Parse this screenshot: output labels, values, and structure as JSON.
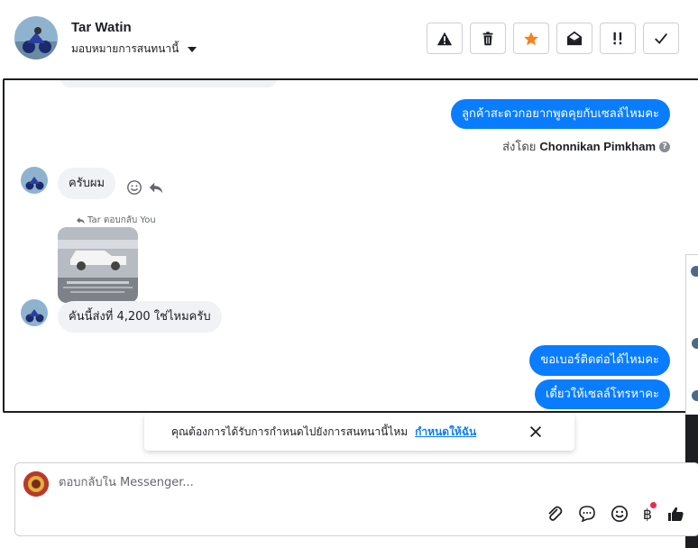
{
  "header": {
    "contact_name": "Tar Watin",
    "assign_label": "มอบหมายการสนทนานี้",
    "toolbar": [
      {
        "icon": "warning-icon",
        "name": "mark-spam-button"
      },
      {
        "icon": "trash-icon",
        "name": "delete-button"
      },
      {
        "icon": "star-icon",
        "name": "star-button"
      },
      {
        "icon": "envelope-open-icon",
        "name": "mark-unread-button"
      },
      {
        "icon": "follow-up-icon",
        "name": "follow-up-button"
      },
      {
        "icon": "check-icon",
        "name": "mark-done-button"
      }
    ]
  },
  "messages": {
    "out_1": "ลูกค้าสะดวกอยากพูดคุยกับเซลล์ไหมคะ",
    "sent_by_prefix": "ส่งโดย",
    "sent_by_name": "Chonnikan Pimkham",
    "help_mark": "?",
    "in_1": "ครับผม",
    "reply_note": "Tar ตอบกลับ You",
    "in_2": "คันนี้ส่งที่ 4,200 ใช่ไหมครับ",
    "out_2": "ขอเบอร์ติดต่อได้ไหมคะ",
    "out_3": "เดี๋ยวให้เซลล์โทรหาคะ"
  },
  "assign_prompt": {
    "text": "คุณต้องการได้รับการกำหนดไปยังการสนทนานี้ไหม",
    "link": "กำหนดให้ฉัน"
  },
  "composer": {
    "placeholder": "ตอบกลับใน Messenger...",
    "currency_symbol": "฿"
  },
  "colors": {
    "accent": "#0a7cff",
    "bubble_in": "#f0f2f5",
    "star": "#f5821f",
    "notif": "#f02849"
  }
}
